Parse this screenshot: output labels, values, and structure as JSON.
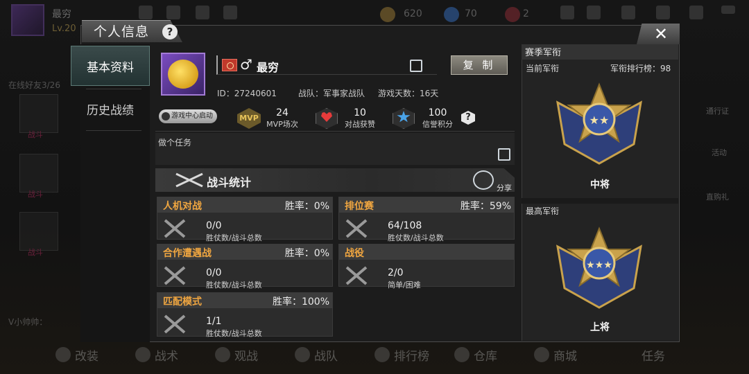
{
  "hud": {
    "player_name": "最穷",
    "level": "Lv.20",
    "currency_a": "620",
    "currency_b": "70",
    "currency_c": "2",
    "online_friends": "在线好友3/26",
    "left_card_labels": [
      "战斗",
      "战斗",
      "战斗"
    ],
    "chat_text": "V小帅帅：",
    "right_labels": [
      "通行证",
      "活动",
      "直购礼"
    ],
    "bottom_nav": [
      "改装",
      "战术",
      "观战",
      "战队",
      "排行榜",
      "仓库",
      "商城",
      "任务"
    ]
  },
  "dialog": {
    "title": "个人信息",
    "help": "?",
    "close": "✕"
  },
  "tabs": {
    "basic": "基本资料",
    "history": "历史战绩"
  },
  "profile": {
    "name": "最穷",
    "gender_symbol": "♂",
    "copy_button": "复 制",
    "id_text": "ID：27240601",
    "team_text": "战队：军事家战队",
    "days_text": "游戏天数：16天",
    "game_center_badge": "游戏中心启动",
    "mvp_icon_text": "MVP",
    "mvp_value": "24",
    "mvp_label": "MVP场次",
    "likes_value": "10",
    "likes_label": "对战获赞",
    "credit_value": "100",
    "credit_label": "信誉积分",
    "credit_help": "?",
    "task_label": "做个任务"
  },
  "combat": {
    "banner_title": "战斗统计",
    "share_label": "分享",
    "cards": [
      {
        "title": "人机对战",
        "rate": "胜率：0%",
        "value": "0/0",
        "sub": "胜仗数/战斗总数"
      },
      {
        "title": "排位赛",
        "rate": "胜率：59%",
        "value": "64/108",
        "sub": "胜仗数/战斗总数"
      },
      {
        "title": "合作遭遇战",
        "rate": "胜率：0%",
        "value": "0/0",
        "sub": "胜仗数/战斗总数"
      },
      {
        "title": "战役",
        "rate": "",
        "value": "2/0",
        "sub": "简单/困难"
      },
      {
        "title": "匹配模式",
        "rate": "胜率：100%",
        "value": "1/1",
        "sub": "胜仗数/战斗总数"
      }
    ]
  },
  "rank": {
    "header": "赛季军衔",
    "current_label": "当前军衔",
    "current_rank_board": "军衔排行榜：98",
    "current_rank_name": "中将",
    "highest_label": "最高军衔",
    "highest_rank_name": "上将"
  },
  "colors": {
    "card_title_orange": "#f0a640",
    "badge_gold": "#c9a24c",
    "badge_blue": "#3a58a8"
  }
}
